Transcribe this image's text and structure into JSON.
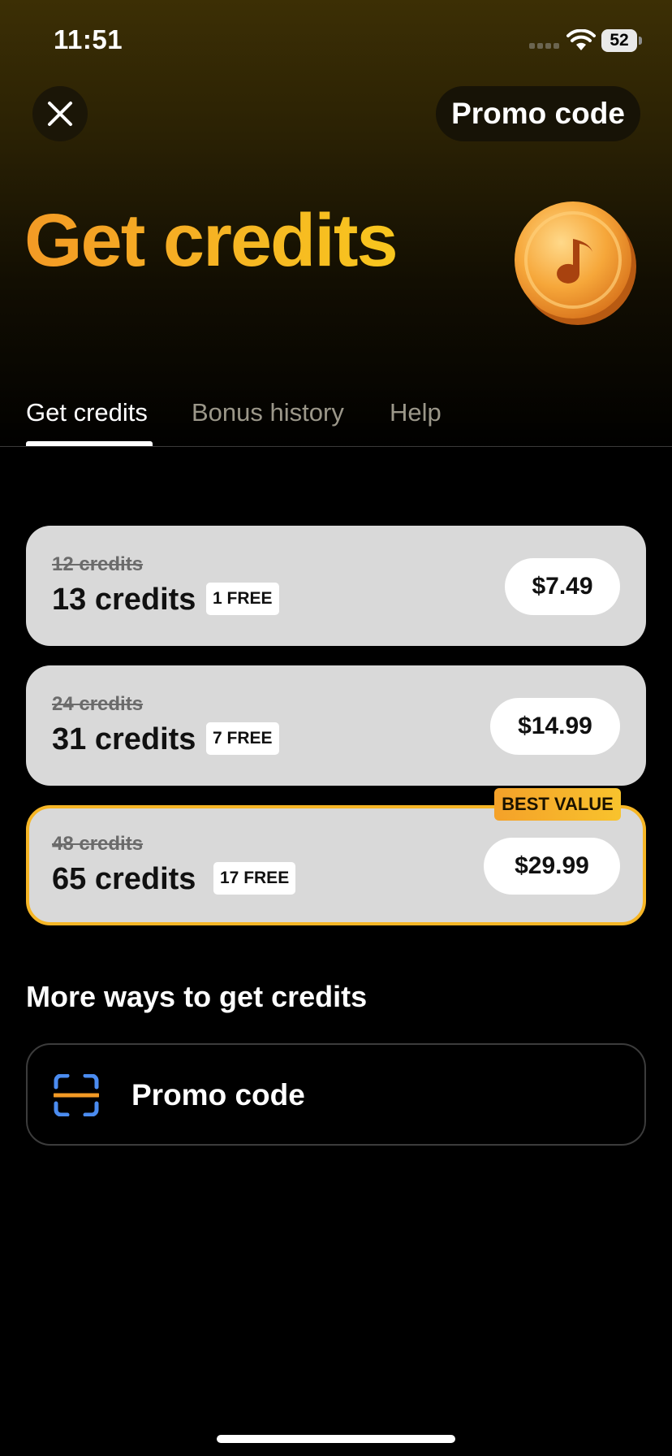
{
  "status_bar": {
    "time": "11:51",
    "battery": "52"
  },
  "header": {
    "promo_button": "Promo code",
    "title": "Get credits"
  },
  "tabs": [
    {
      "label": "Get credits",
      "active": true
    },
    {
      "label": "Bonus history",
      "active": false
    },
    {
      "label": "Help",
      "active": false
    }
  ],
  "offers": [
    {
      "old_credits": "12 credits",
      "credits": "13 credits",
      "free": "1 FREE",
      "price": "$7.49"
    },
    {
      "old_credits": "24 credits",
      "credits": "31 credits",
      "free": "7 FREE",
      "price": "$14.99"
    },
    {
      "old_credits": "48 credits",
      "credits": "65 credits",
      "free": "17 FREE",
      "price": "$29.99",
      "badge": "BEST VALUE"
    }
  ],
  "more_ways": {
    "title": "More ways to get credits",
    "items": [
      {
        "label": "Promo code",
        "icon": "scan-icon"
      }
    ]
  },
  "colors": {
    "accent": "#f6b626",
    "title_gradient_start": "#f39a25",
    "card": "#d9d9d9"
  }
}
